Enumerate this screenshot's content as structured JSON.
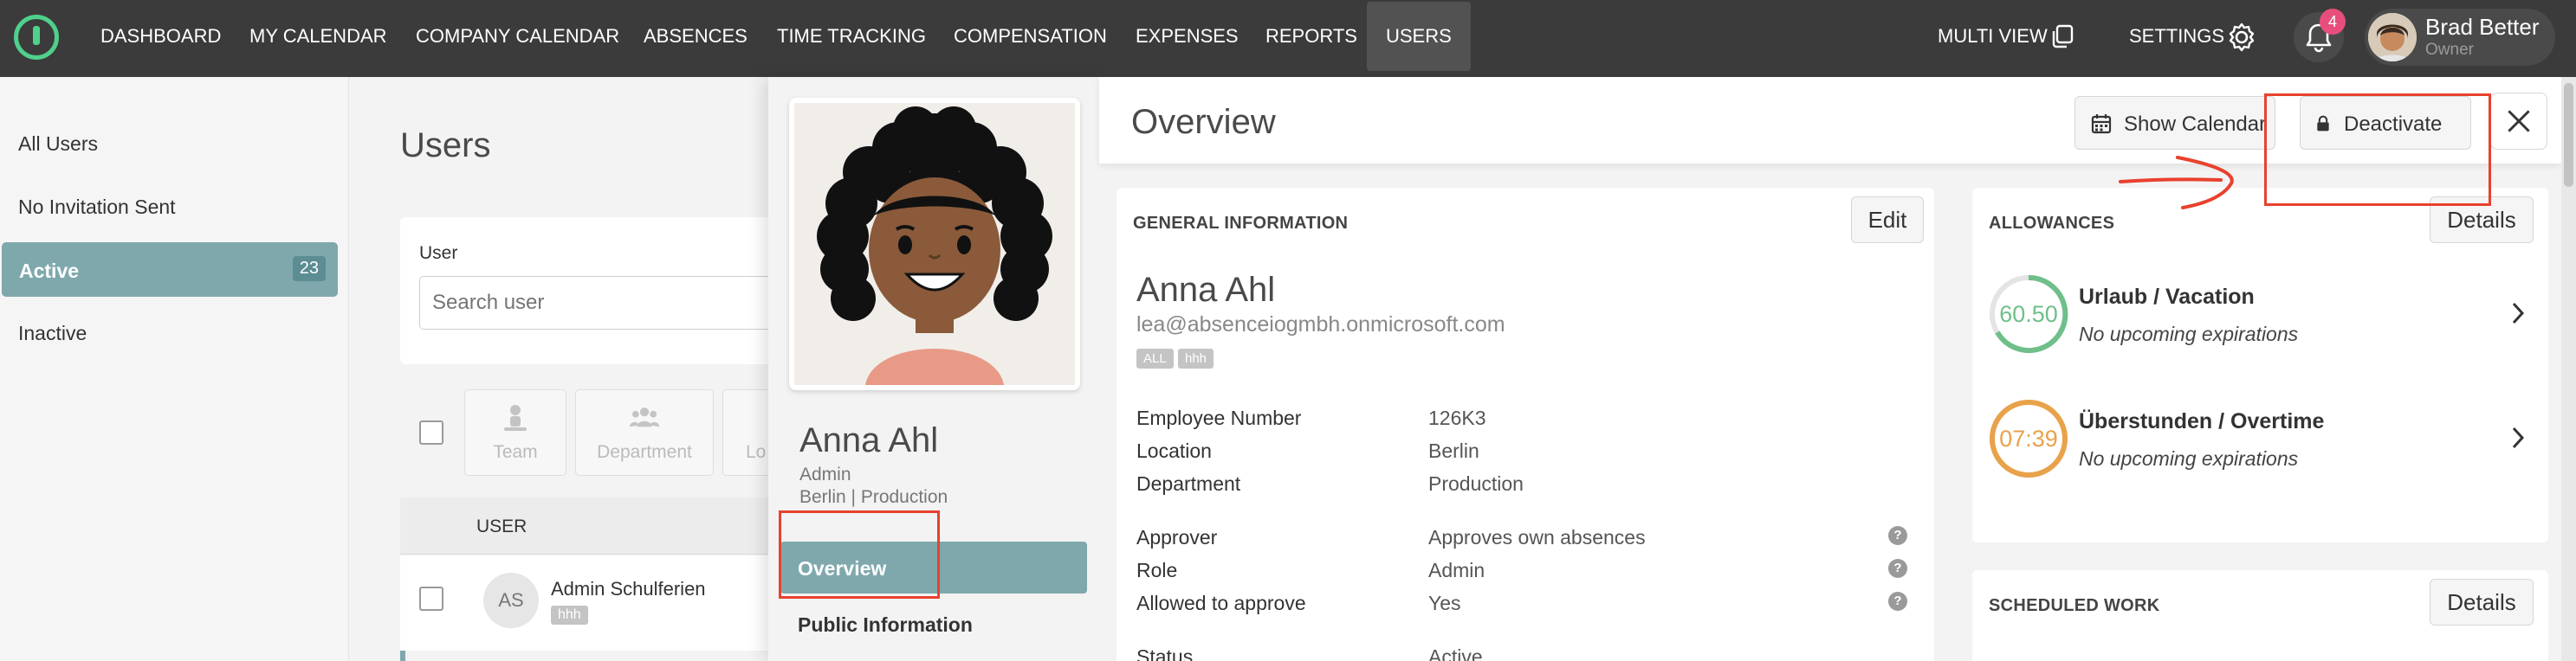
{
  "nav": {
    "items": [
      "DASHBOARD",
      "MY CALENDAR",
      "COMPANY CALENDAR",
      "ABSENCES",
      "TIME TRACKING",
      "COMPENSATION",
      "EXPENSES",
      "REPORTS",
      "USERS"
    ],
    "active": "USERS",
    "multi_view": "MULTI VIEW",
    "settings": "SETTINGS",
    "notification_count": "4",
    "user_name": "Brad Better",
    "user_role": "Owner",
    "icons": [
      "logo-icon",
      "copy-icon",
      "gear-icon",
      "bell-icon"
    ]
  },
  "sidebar": {
    "items": [
      {
        "label": "All Users"
      },
      {
        "label": "No Invitation Sent"
      },
      {
        "label": "Active",
        "count": "23",
        "active": true
      },
      {
        "label": "Inactive"
      }
    ]
  },
  "users_page": {
    "title": "Users",
    "user_label": "User",
    "search_placeholder": "Search user",
    "filters": [
      "Team",
      "Department",
      "Lo"
    ],
    "table_header": "USER",
    "rows": [
      {
        "initials": "AS",
        "name": "Admin Schulferien",
        "tag": "hhh"
      }
    ]
  },
  "profile_panel": {
    "name": "Anna Ahl",
    "role": "Admin",
    "location": "Berlin | Production",
    "tabs": [
      "Overview",
      "Public Information"
    ],
    "active_tab": "Overview"
  },
  "overview": {
    "title": "Overview",
    "show_calendar_label": "Show Calendar",
    "deactivate_label": "Deactivate",
    "general": {
      "title": "GENERAL INFORMATION",
      "edit_label": "Edit",
      "name": "Anna Ahl",
      "email": "lea@absenceiogmbh.onmicrosoft.com",
      "tags": [
        "ALL",
        "hhh"
      ],
      "fields": [
        {
          "label": "Employee Number",
          "value": "126K3"
        },
        {
          "label": "Location",
          "value": "Berlin"
        },
        {
          "label": "Department",
          "value": "Production"
        },
        {
          "label": "Approver",
          "value": "Approves own absences",
          "help": true
        },
        {
          "label": "Role",
          "value": "Admin",
          "help": true
        },
        {
          "label": "Allowed to approve",
          "value": "Yes",
          "help": true
        },
        {
          "label": "Status",
          "value": "Active"
        }
      ]
    },
    "allowances": {
      "title": "ALLOWANCES",
      "details_label": "Details",
      "items": [
        {
          "value": "60.50",
          "title": "Urlaub / Vacation",
          "subtitle": "No upcoming expirations",
          "color": "#6fbf8a"
        },
        {
          "value": "07:39",
          "title": "Überstunden / Overtime",
          "subtitle": "No upcoming expirations",
          "color": "#e8a24a"
        }
      ]
    },
    "scheduled_work": {
      "title": "SCHEDULED WORK",
      "details_label": "Details"
    }
  },
  "colors": {
    "topbar": "#3b3b3b",
    "accent": "#7fa8ad",
    "annotation": "#e8412d"
  }
}
